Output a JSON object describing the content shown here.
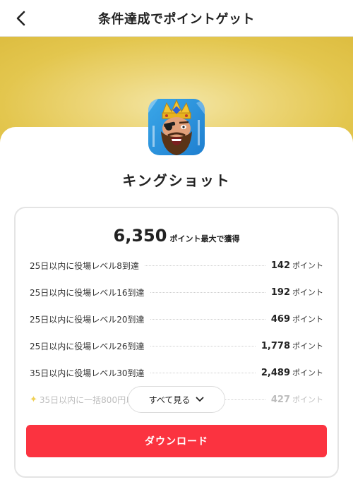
{
  "header": {
    "title": "条件達成でポイントゲット"
  },
  "app": {
    "name": "キングショット"
  },
  "rewards": {
    "total_points": "6,350",
    "total_label": "ポイント最大で獲得",
    "tasks": [
      {
        "label": "25日以内に役場レベル8到達",
        "points": "142",
        "unit": "ポイント"
      },
      {
        "label": "25日以内に役場レベル16到達",
        "points": "192",
        "unit": "ポイント"
      },
      {
        "label": "25日以内に役場レベル20到達",
        "points": "469",
        "unit": "ポイント"
      },
      {
        "label": "25日以内に役場レベル26到達",
        "points": "1,778",
        "unit": "ポイント"
      },
      {
        "label": "35日以内に役場レベル30到達",
        "points": "2,489",
        "unit": "ポイント"
      },
      {
        "label": "35日以内に一括800円以",
        "points": "427",
        "unit": "ポイント"
      }
    ]
  },
  "see_all_label": "すべて見る",
  "download_label": "ダウンロード",
  "colors": {
    "accent": "#fb3340",
    "banner": "#e3c64e"
  }
}
